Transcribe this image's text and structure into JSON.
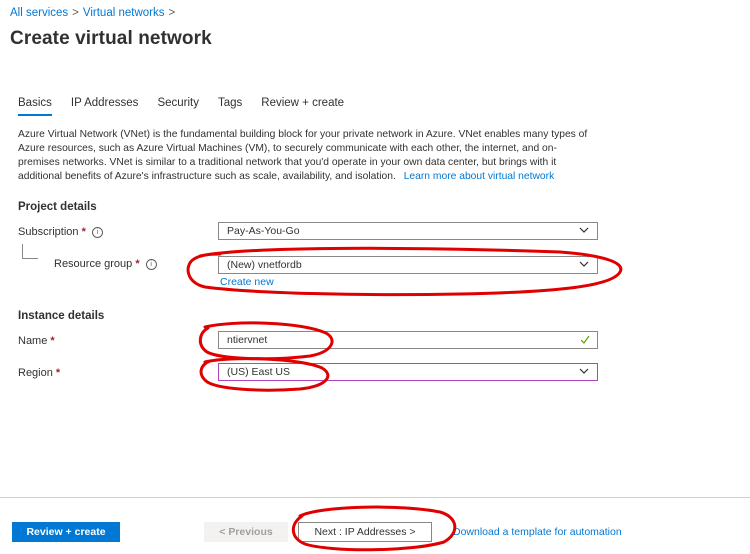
{
  "breadcrumb": {
    "items": [
      "All services",
      "Virtual networks"
    ],
    "separator": ">"
  },
  "page_title": "Create virtual network",
  "tabs": [
    {
      "label": "Basics",
      "active": true
    },
    {
      "label": "IP Addresses",
      "active": false
    },
    {
      "label": "Security",
      "active": false
    },
    {
      "label": "Tags",
      "active": false
    },
    {
      "label": "Review + create",
      "active": false
    }
  ],
  "description": {
    "text": "Azure Virtual Network (VNet) is the fundamental building block for your private network in Azure. VNet enables many types of Azure resources, such as Azure Virtual Machines (VM), to securely communicate with each other, the internet, and on-premises networks. VNet is similar to a traditional network that you'd operate in your own data center, but brings with it additional benefits of Azure's infrastructure such as scale, availability, and isolation.",
    "link": "Learn more about virtual network"
  },
  "project_details": {
    "heading": "Project details",
    "subscription": {
      "label": "Subscription",
      "value": "Pay-As-You-Go"
    },
    "resource_group": {
      "label": "Resource group",
      "value": "(New) vnetfordb",
      "create_new": "Create new"
    }
  },
  "instance_details": {
    "heading": "Instance details",
    "name": {
      "label": "Name",
      "value": "ntiervnet"
    },
    "region": {
      "label": "Region",
      "value": "(US) East US"
    }
  },
  "footer": {
    "review_create": "Review + create",
    "previous": "< Previous",
    "next": "Next : IP Addresses >",
    "download_link": "Download a template for automation"
  },
  "colors": {
    "accent": "#0078d4",
    "required": "#a4262c",
    "annotation": "#e00000",
    "valid": "#57a300"
  },
  "icons": [
    "info-icon",
    "chevron-down-icon",
    "checkmark-icon"
  ]
}
